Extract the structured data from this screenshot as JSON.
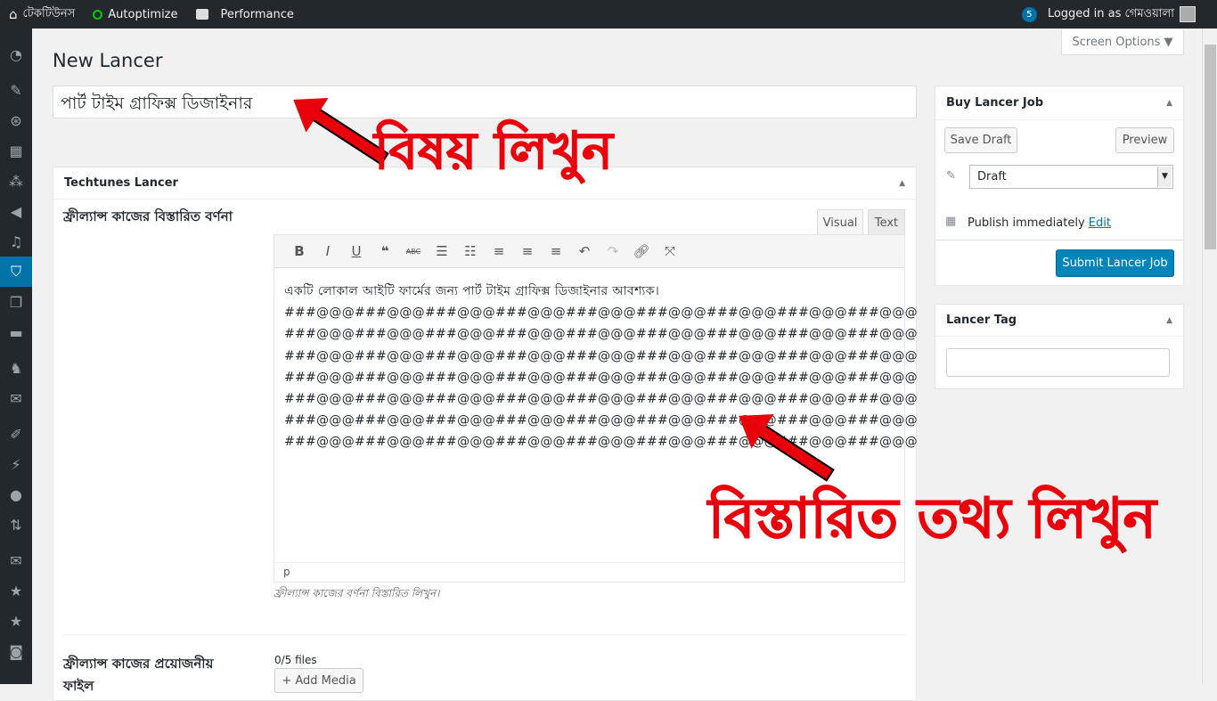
{
  "adminbar": {
    "site": "টেকটিউনস",
    "autoptimize": "Autoptimize",
    "performance": "Performance",
    "notif_count": "5",
    "logged_in": "Logged in as গেমওয়ালা"
  },
  "screen_options": "Screen Options ▼",
  "page_title": "New Lancer",
  "post_title": "পার্ট টাইম গ্রাফিক্স ডিজাইনার",
  "metabox": {
    "title": "Techtunes Lancer",
    "desc_label": "ফ্রীল্যান্স কাজের বিস্তারিত বর্ণনা",
    "tab_visual": "Visual",
    "tab_text": "Text",
    "first_line": "একটি লোকাল আইটি ফার্মের জন্য পার্ট টাইম গ্রাফিক্স ডিজাইনার আবশ্যক।",
    "lines": [
      "###@@@###@@@###@@@###@@@###@@@###@@@###@@@###@@@###@@@",
      "###@@@###@@@###@@@###@@@###@@@###@@@###@@@###@@@###@@@",
      "###@@@###@@@###@@@###@@@###@@@###@@@###@@@###@@@###@@@",
      "###@@@###@@@###@@@###@@@###@@@###@@@###@@@###@@@###@@@",
      "###@@@###@@@###@@@###@@@###@@@###@@@###@@@###@@@###@@@",
      "###@@@###@@@###@@@###@@@###@@@###@@@###@@@###@@@###@@@",
      "###@@@###@@@###@@@###@@@###@@@###@@@###@@@###@@@###@@@"
    ],
    "path": "p",
    "hint": "ফ্রীল্যান্স কাজের বর্ণনা বিস্তারিত লিখুন।",
    "files_label": "ফ্রীল্যান্স কাজের প্রয়োজনীয় ফাইল",
    "files_count": "0/5 files",
    "add_media": "+ Add Media"
  },
  "publish": {
    "title": "Buy Lancer Job",
    "save_draft": "Save Draft",
    "preview": "Preview",
    "status": "Draft",
    "publish_text": "Publish immediately",
    "edit": "Edit",
    "submit": "Submit Lancer Job"
  },
  "tag": {
    "title": "Lancer Tag",
    "value": ""
  },
  "annotations": {
    "title_hint": "বিষয় লিখুন",
    "body_hint": "বিস্তারিত তথ্য লিখুন"
  }
}
